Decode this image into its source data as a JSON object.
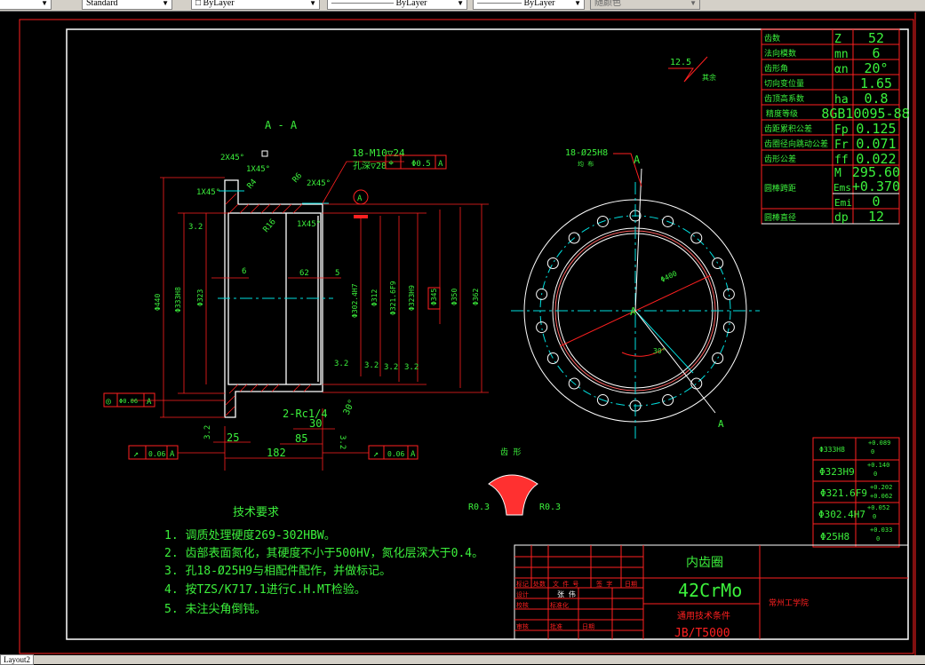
{
  "toolbar": {
    "text_style": "Standard",
    "layer": "ByLayer",
    "linetype": "ByLayer",
    "lineweight": "ByLayer",
    "color": "随颜色"
  },
  "status": {
    "layout_tab": "Layout2"
  },
  "section_view": {
    "title": "A - A",
    "chamfers": [
      "2X45°",
      "1X45°",
      "1X45°",
      "2X45°",
      "1X45°"
    ],
    "radii": [
      "R4",
      "R6",
      "R16"
    ],
    "thread_note": "18-M10▽24",
    "thread_depth": "孔深▽28",
    "position_tol": {
      "symbol": "⌖",
      "value": "Φ0.5",
      "datum": "A"
    },
    "datum_label": "A",
    "diameters": [
      "Φ440",
      "Φ333H8",
      "Φ323",
      "Φ302.4H7",
      "Φ312",
      "Φ321.6F9",
      "Φ323H9",
      "Φ345",
      "Φ350",
      "Φ362"
    ],
    "roughness": [
      "3.2",
      "3.2",
      "3.2",
      "3.2",
      "3.2",
      "3.2",
      "3.2"
    ],
    "lengths": [
      "6",
      "62",
      "5",
      "25",
      "30",
      "85",
      "182"
    ],
    "pipe_note": "2-Rc1/4",
    "angle": "30°",
    "runout_left": {
      "symbol": "↗",
      "value": "0.06",
      "datum": "A"
    },
    "runout_right": {
      "symbol": "↗",
      "value": "0.06",
      "datum": "A"
    },
    "coaxial": {
      "symbol": "◎",
      "value": "Φ0.06",
      "datum": "A"
    }
  },
  "front_view": {
    "hole_note": "18-Ø25H8",
    "hole_sub": "均 布",
    "diameter": "Φ400",
    "angle": "30°",
    "section_mark": "A",
    "roughness_other": "12.5",
    "roughness_other_label": "其余"
  },
  "tooth_profile": {
    "title": "齿 形",
    "r_left": "R0.3",
    "r_right": "R0.3"
  },
  "gear_params": [
    {
      "name": "齿数",
      "sym": "Z",
      "val": "52"
    },
    {
      "name": "法向模数",
      "sym": "mn",
      "val": "6"
    },
    {
      "name": "齿形角",
      "sym": "αn",
      "val": "20°"
    },
    {
      "name": "切向变位量",
      "sym": "",
      "val": "1.65"
    },
    {
      "name": "齿顶高系数",
      "sym": "ha",
      "val": "0.8"
    },
    {
      "name": "精度等级",
      "sym": "",
      "val": "8GB10095-88"
    },
    {
      "name": "齿距累积公差",
      "sym": "Fp",
      "val": "0.125"
    },
    {
      "name": "齿圈径向跳动公差",
      "sym": "Fr",
      "val": "0.071"
    },
    {
      "name": "齿形公差",
      "sym": "ff",
      "val": "0.022"
    },
    {
      "name": "圆棒跨距",
      "sym": "M",
      "val": "295.60",
      "sym2": "Ems",
      "val2": "+0.370",
      "sym3": "Emi",
      "val3": "0"
    },
    {
      "name": "圆棒直径",
      "sym": "dp",
      "val": "12"
    }
  ],
  "tolerances": [
    {
      "fit": "Φ333H8",
      "upper": "+0.089",
      "lower": "0"
    },
    {
      "fit": "Φ323H9",
      "upper": "+0.140",
      "lower": "0"
    },
    {
      "fit": "Φ321.6F9",
      "upper": "+0.202",
      "lower": "+0.062"
    },
    {
      "fit": "Φ302.4H7",
      "upper": "+0.052",
      "lower": "0"
    },
    {
      "fit": "Φ25H8",
      "upper": "+0.033",
      "lower": "0"
    }
  ],
  "tech_requirements": {
    "title": "技术要求",
    "items": [
      "1. 调质处理硬度269-302HBW。",
      "2. 齿部表面氮化，其硬度不小于500HV，氮化层深大于0.4。",
      "3. 孔18-Ø25H9与相配件配作，并做标记。",
      "4. 按TZS/K717.1进行C.H.MT检验。",
      "5. 未注尖角倒钝。"
    ]
  },
  "title_block": {
    "part_name": "内齿圈",
    "material": "42CrMo",
    "standard_label": "通用技术条件",
    "standard": "JB/T5000",
    "school": "常州工学院",
    "headers": [
      "标记",
      "处数",
      "文 件 号",
      "签 字",
      "日期"
    ],
    "rows": [
      "设计",
      "校核",
      "审核",
      "批准",
      "标准化",
      "日期"
    ],
    "signer": "张 伟"
  }
}
